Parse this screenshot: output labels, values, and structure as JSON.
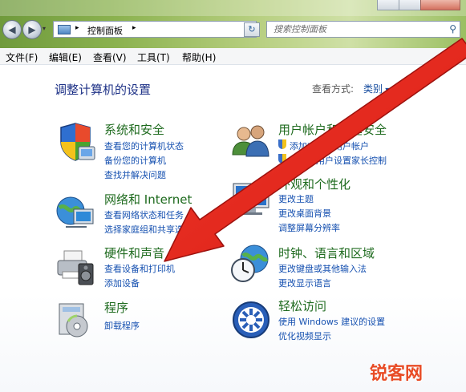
{
  "window": {
    "address": {
      "crumb": "控制面板",
      "sep": "▸",
      "dropdown": "▾"
    },
    "search": {
      "placeholder": "搜索控制面板"
    }
  },
  "menu": [
    {
      "label": "文件(F)"
    },
    {
      "label": "编辑(E)"
    },
    {
      "label": "查看(V)"
    },
    {
      "label": "工具(T)"
    },
    {
      "label": "帮助(H)"
    }
  ],
  "page": {
    "title": "调整计算机的设置",
    "view_by_label": "查看方式:",
    "view_by_value": "类别"
  },
  "categories": [
    {
      "title": "系统和安全",
      "links": [
        "查看您的计算机状态",
        "备份您的计算机",
        "查找并解决问题"
      ],
      "icon": "shield-icon"
    },
    {
      "title": "网络和 Internet",
      "links": [
        "查看网络状态和任务",
        "选择家庭组和共享选项"
      ],
      "icon": "network-globe-icon"
    },
    {
      "title": "硬件和声音",
      "links": [
        "查看设备和打印机",
        "添加设备"
      ],
      "icon": "printer-icon"
    },
    {
      "title": "程序",
      "links": [
        "卸载程序"
      ],
      "icon": "programs-icon"
    },
    {
      "title": "用户帐户和家庭安全",
      "links": [
        "添加或删除用户帐户",
        "为所有用户设置家长控制"
      ],
      "icon": "users-icon"
    },
    {
      "title": "外观和个性化",
      "links": [
        "更改主题",
        "更改桌面背景",
        "调整屏幕分辨率"
      ],
      "icon": "monitor-icon"
    },
    {
      "title": "时钟、语言和区域",
      "links": [
        "更改键盘或其他输入法",
        "更改显示语言"
      ],
      "icon": "clock-globe-icon"
    },
    {
      "title": "轻松访问",
      "links": [
        "使用 Windows 建议的设置",
        "优化视频显示"
      ],
      "icon": "ease-of-access-icon"
    }
  ],
  "watermark": "锐客网",
  "colors": {
    "arrow": "#e8261e",
    "link": "#1550b0",
    "category_title": "#1f6b1f",
    "page_title": "#1e3287"
  }
}
